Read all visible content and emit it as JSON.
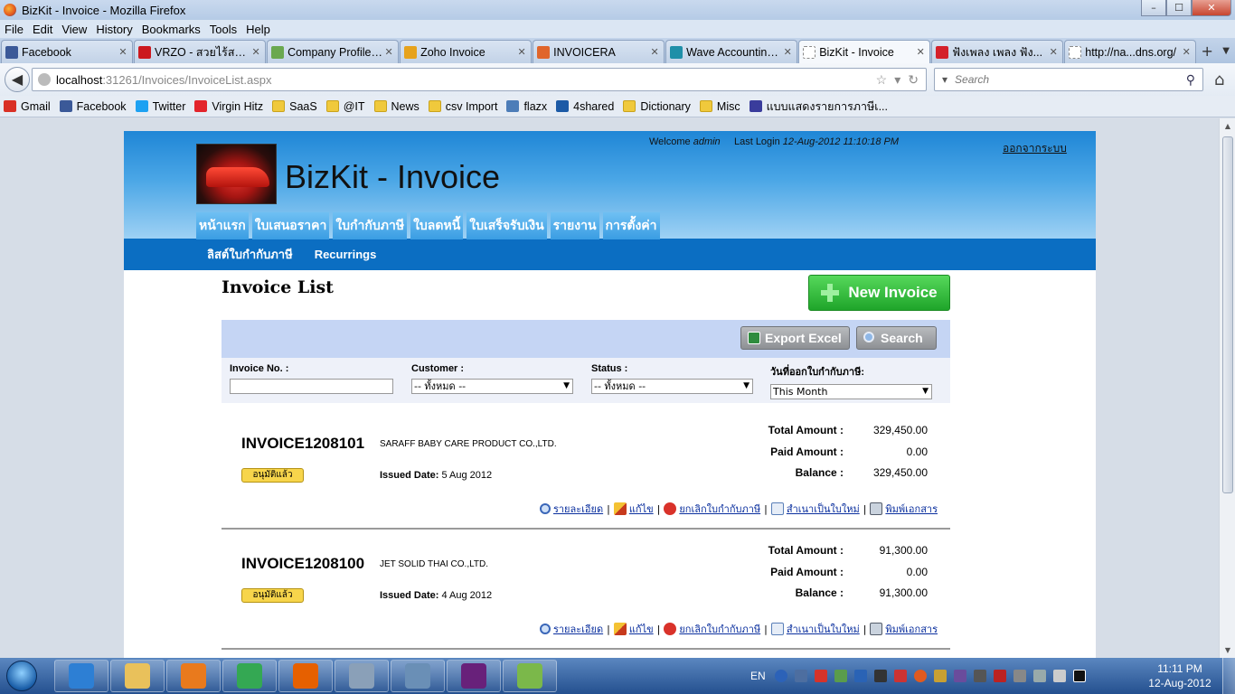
{
  "window": {
    "title": "BizKit - Invoice - Mozilla Firefox",
    "controls": [
      "–",
      "☐",
      "✕"
    ]
  },
  "menu": [
    "File",
    "Edit",
    "View",
    "History",
    "Bookmarks",
    "Tools",
    "Help"
  ],
  "tabs": [
    {
      "label": "Facebook",
      "icon": "facebook-icon",
      "color": "#3b5998",
      "active": false
    },
    {
      "label": "VRZO - สวยไร้สม...",
      "icon": "youtube-icon",
      "color": "#cc181e",
      "active": false
    },
    {
      "label": "Company Profile: ...",
      "icon": "pencil-icon",
      "color": "#6aa84f",
      "active": false
    },
    {
      "label": "Zoho Invoice",
      "icon": "zoho-icon",
      "color": "#e6a21c",
      "active": false
    },
    {
      "label": "INVOICERA",
      "icon": "invoicera-icon",
      "color": "#e0652b",
      "active": false
    },
    {
      "label": "Wave Accounting...",
      "icon": "wave-icon",
      "color": "#1f8fa8",
      "active": false
    },
    {
      "label": "BizKit - Invoice",
      "icon": "blank-page-icon",
      "color": "#ffffff",
      "active": true
    },
    {
      "label": "ฟังเพลง เพลง ฟัง...",
      "icon": "music-icon",
      "color": "#d4202a",
      "active": false
    },
    {
      "label": "http://na...dns.org/",
      "icon": "blank-page-icon",
      "color": "#ffffff",
      "active": false
    }
  ],
  "nav": {
    "url_host": "localhost",
    "url_rest": ":31261/Invoices/InvoiceList.aspx",
    "search_placeholder": "Search"
  },
  "bookmarks": [
    {
      "label": "Gmail",
      "icon": "gmail-icon",
      "color": "#d93025"
    },
    {
      "label": "Facebook",
      "icon": "facebook-icon",
      "color": "#3b5998"
    },
    {
      "label": "Twitter",
      "icon": "twitter-icon",
      "color": "#1da1f2"
    },
    {
      "label": "Virgin Hitz",
      "icon": "virgin-icon",
      "color": "#e3242b"
    },
    {
      "label": "SaaS",
      "icon": "folder-icon",
      "color": "folder"
    },
    {
      "label": "@IT",
      "icon": "folder-icon",
      "color": "folder"
    },
    {
      "label": "News",
      "icon": "folder-icon",
      "color": "folder"
    },
    {
      "label": "csv Import",
      "icon": "folder-icon",
      "color": "folder"
    },
    {
      "label": "flazx",
      "icon": "flazx-icon",
      "color": "#4d7db8"
    },
    {
      "label": "4shared",
      "icon": "4shared-icon",
      "color": "#1c5aa6"
    },
    {
      "label": "Dictionary",
      "icon": "folder-icon",
      "color": "folder"
    },
    {
      "label": "Misc",
      "icon": "folder-icon",
      "color": "folder"
    },
    {
      "label": "แบบแสดงรายการภาษีเ...",
      "icon": "revenue-dept-icon",
      "color": "#3a3c9c"
    }
  ],
  "site": {
    "title": "BizKit - Invoice",
    "welcome_prefix": "Welcome",
    "user": "admin",
    "last_login_label": "Last Login",
    "last_login": "12-Aug-2012 11:10:18 PM",
    "logout": "ออกจากระบบ",
    "main_nav": [
      "หน้าแรก",
      "ใบเสนอราคา",
      "ใบกำกับภาษี",
      "ใบลดหนี้",
      "ใบเสร็จรับเงิน",
      "รายงาน",
      "การตั้งค่า"
    ],
    "sub_nav": [
      "ลิสต์ใบกำกับภาษี",
      "Recurrings"
    ]
  },
  "page": {
    "title": "Invoice List",
    "new_invoice": "New Invoice",
    "export_excel": "Export Excel",
    "search": "Search",
    "filters": {
      "invoice_no_label": "Invoice No. :",
      "invoice_no_value": "",
      "customer_label": "Customer :",
      "customer_value": "-- ทั้งหมด --",
      "status_label": "Status :",
      "status_value": "-- ทั้งหมด --",
      "date_label": "วันที่ออกใบกำกับภาษี:",
      "date_value": "This Month"
    },
    "labels": {
      "total": "Total Amount :",
      "paid": "Paid Amount :",
      "balance": "Balance :",
      "issued": "Issued Date:"
    },
    "actions": [
      "รายละเอียด",
      "แก้ไข",
      "ยกเลิกใบกำกับภาษี",
      "สำเนาเป็นใบใหม่",
      "พิมพ์เอกสาร"
    ],
    "invoices": [
      {
        "no": "INVOICE1208101",
        "customer": "SARAFF BABY CARE PRODUCT CO.,LTD.",
        "status": "อนุมัติแล้ว",
        "issued": "5 Aug 2012",
        "total": "329,450.00",
        "paid": "0.00",
        "balance": "329,450.00"
      },
      {
        "no": "INVOICE1208100",
        "customer": "JET SOLID THAI CO.,LTD.",
        "status": "อนุมัติแล้ว",
        "issued": "4 Aug 2012",
        "total": "91,300.00",
        "paid": "0.00",
        "balance": "91,300.00"
      }
    ]
  },
  "taskbar": {
    "apps": [
      {
        "name": "ie-icon",
        "color": "#2d7fd4"
      },
      {
        "name": "explorer-icon",
        "color": "#e9c15b"
      },
      {
        "name": "media-player-icon",
        "color": "#e97a1d"
      },
      {
        "name": "chrome-icon",
        "color": "#34a853"
      },
      {
        "name": "firefox-icon",
        "color": "#e66000"
      },
      {
        "name": "vmware-icon",
        "color": "#8aa0b8"
      },
      {
        "name": "tools-icon",
        "color": "#6a8fb6"
      },
      {
        "name": "visual-studio-icon",
        "color": "#68217a"
      },
      {
        "name": "paint-icon",
        "color": "#7bb84a"
      }
    ],
    "lang": "EN",
    "time": "11:11 PM",
    "date": "12-Aug-2012"
  }
}
